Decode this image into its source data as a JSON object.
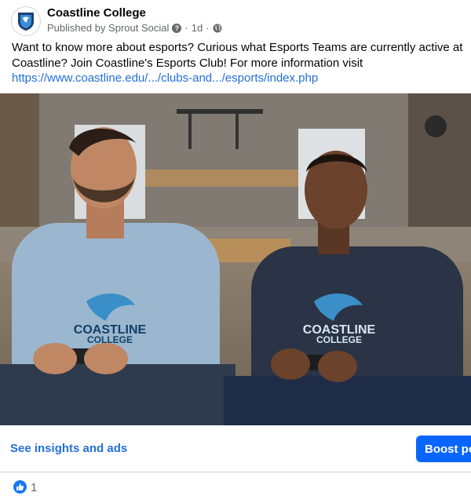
{
  "post": {
    "page_name": "Coastline College",
    "published_by": "Published by Sprout Social",
    "separator": "·",
    "time": "1d",
    "text": "Want to know more about esports? Curious what Esports Teams are currently active at Coastline? Join Coastline's Esports Club! For more information visit",
    "link": "https://www.coastline.edu/.../clubs-and.../esports/index.php"
  },
  "photo": {
    "shirt_logo_line1": "COASTLINE",
    "shirt_logo_line2": "COLLEGE"
  },
  "actions": {
    "insights_label": "See insights and ads",
    "boost_label": "Boost post"
  },
  "reactions": {
    "like_count": "1"
  },
  "colors": {
    "link_blue": "#216fdb",
    "boost_blue": "#0866ff",
    "like_blue": "#1877f2",
    "meta_gray": "#65676b"
  },
  "icons": [
    "coastline-shield-logo-icon",
    "question-icon",
    "globe-icon",
    "like-icon"
  ]
}
